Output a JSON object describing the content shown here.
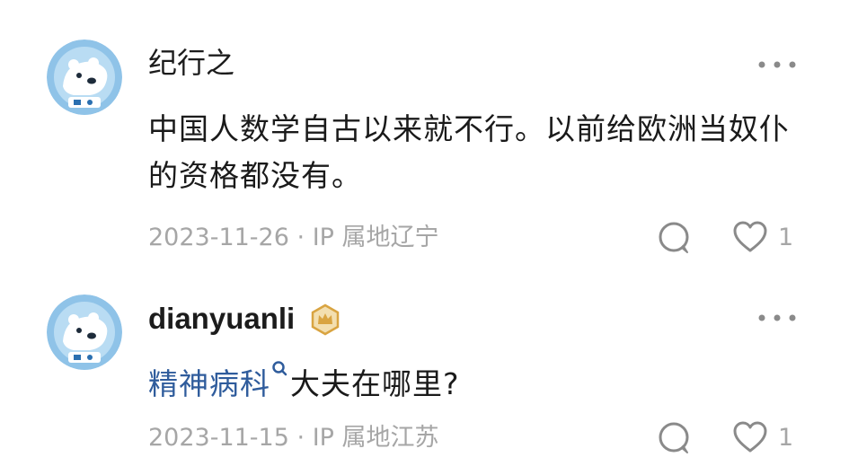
{
  "comments": [
    {
      "username": "纪行之",
      "avatar_icon": "polar-bear-astronaut-avatar",
      "body": "中国人数学自古以来就不行。以前给欧洲当奴仆的资格都没有。",
      "date": "2023-11-26",
      "ip_label": "IP 属地辽宁",
      "reply_icon": "comment-bubble-icon",
      "like_icon": "heart-icon",
      "likes": "1",
      "more_icon": "more-dots-icon"
    },
    {
      "username": "dianyuanli",
      "avatar_icon": "polar-bear-astronaut-avatar",
      "badge_icon": "gold-crown-badge-icon",
      "body_link": "精神病科",
      "body_rest": "大夫在哪里?",
      "date": "2023-11-15",
      "ip_label": "IP 属地江苏",
      "reply_icon": "comment-bubble-icon",
      "like_icon": "heart-icon",
      "likes": "1",
      "more_icon": "more-dots-icon"
    }
  ],
  "colors": {
    "text": "#1a1a1a",
    "meta": "#a6a6a6",
    "link": "#2f5c9c",
    "avatar_bg": "#8fc3e8",
    "badge": "#d9a441"
  }
}
